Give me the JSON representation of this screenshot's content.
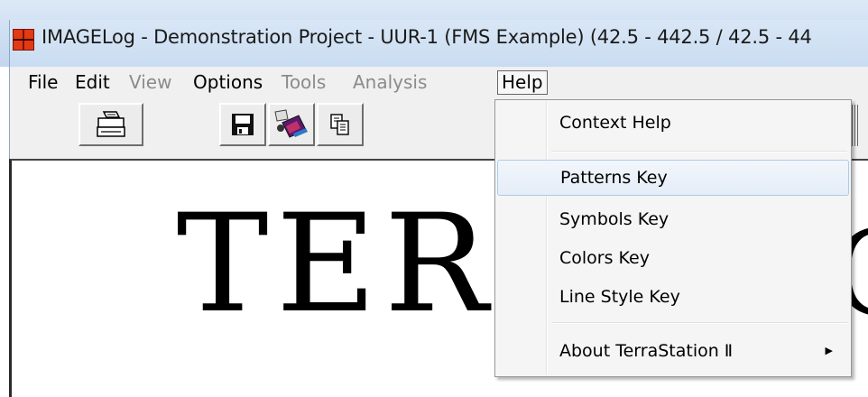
{
  "window": {
    "title": "IMAGELog - Demonstration Project - UUR-1 (FMS Example) (42.5 - 442.5 / 42.5 - 44"
  },
  "menubar": {
    "items": [
      {
        "label": "File",
        "enabled": true
      },
      {
        "label": "Edit",
        "enabled": true
      },
      {
        "label": "View",
        "enabled": false
      },
      {
        "label": "Options",
        "enabled": true
      },
      {
        "label": "Tools",
        "enabled": false
      },
      {
        "label": "Analysis",
        "enabled": false
      },
      {
        "label": "Help",
        "enabled": true,
        "open": true
      }
    ]
  },
  "toolbar": {
    "buttons": [
      {
        "icon": "printer-icon"
      },
      {
        "icon": "save-disk-icon"
      },
      {
        "icon": "export-image-icon"
      },
      {
        "icon": "copy-icon"
      }
    ]
  },
  "canvas": {
    "text_main": "TER",
    "text_partial": "C"
  },
  "help_menu": {
    "items": [
      {
        "label": "Context Help"
      },
      {
        "label": "Patterns Key",
        "highlighted": true
      },
      {
        "label": "Symbols Key"
      },
      {
        "label": "Colors Key"
      },
      {
        "label": "Line Style Key"
      },
      {
        "label": "About TerraStation Ⅱ",
        "has_submenu": true
      }
    ]
  },
  "colors": {
    "title_bar": "#cfe0f3",
    "menu_bg": "#f0f0f0",
    "hover_border": "#aecbe9",
    "disabled_text": "#8b8b8b"
  }
}
